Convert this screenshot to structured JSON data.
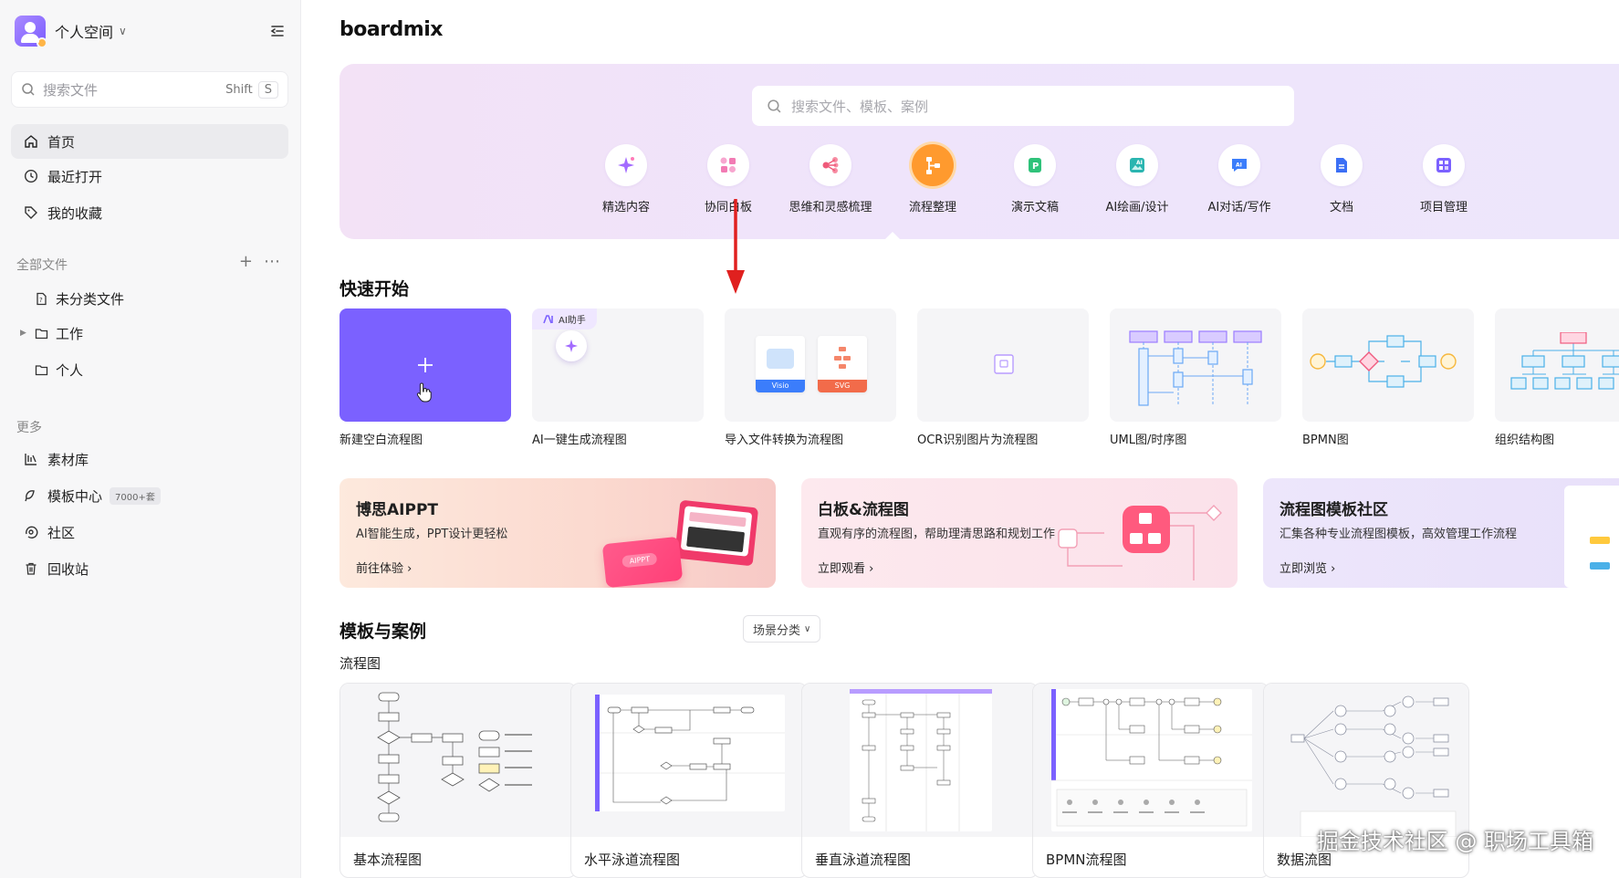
{
  "sidebar": {
    "space_name": "个人空间",
    "search": {
      "placeholder": "搜索文件",
      "shortcut_1": "Shift",
      "shortcut_2": "S"
    },
    "nav": [
      {
        "label": "首页",
        "icon": "home-icon",
        "active": true
      },
      {
        "label": "最近打开",
        "icon": "clock-icon"
      },
      {
        "label": "我的收藏",
        "icon": "tag-icon"
      }
    ],
    "files_section": "全部文件",
    "tree": [
      {
        "label": "未分类文件",
        "icon": "file-icon"
      },
      {
        "label": "工作",
        "icon": "folder-icon"
      },
      {
        "label": "个人",
        "icon": "folder-icon"
      }
    ],
    "more_section": "更多",
    "more": [
      {
        "label": "素材库",
        "icon": "library-icon"
      },
      {
        "label": "模板中心",
        "icon": "template-icon",
        "badge": "7000+套"
      },
      {
        "label": "社区",
        "icon": "community-icon"
      },
      {
        "label": "回收站",
        "icon": "trash-icon"
      }
    ]
  },
  "main": {
    "logo": "boardmix",
    "hero_search_placeholder": "搜索文件、模板、案例",
    "categories": [
      {
        "label": "精选内容",
        "icon": "sparkle-icon",
        "color": "#a36bff"
      },
      {
        "label": "协同白板",
        "icon": "whiteboard-icon",
        "color": "#f27bb4"
      },
      {
        "label": "思维和灵感梳理",
        "icon": "mindmap-icon",
        "color": "#ef5a7a"
      },
      {
        "label": "流程整理",
        "icon": "flowchart-icon",
        "color": "#ff9a2e",
        "active": true
      },
      {
        "label": "演示文稿",
        "icon": "presentation-icon",
        "color": "#2fc27a"
      },
      {
        "label": "AI绘画/设计",
        "icon": "ai-paint-icon",
        "color": "#2ab5b0"
      },
      {
        "label": "AI对话/写作",
        "icon": "ai-chat-icon",
        "color": "#3b7dfb"
      },
      {
        "label": "文档",
        "icon": "document-icon",
        "color": "#3b6ff5"
      },
      {
        "label": "项目管理",
        "icon": "project-icon",
        "color": "#7b61ff"
      }
    ],
    "quick_start_title": "快速开始",
    "quick_start": [
      {
        "label": "新建空白流程图"
      },
      {
        "label": "AI一键生成流程图",
        "tag": "AI助手"
      },
      {
        "label": "导入文件转换为流程图",
        "file_tags": [
          "Visio",
          "SVG"
        ]
      },
      {
        "label": "OCR识别图片为流程图"
      },
      {
        "label": "UML图/时序图"
      },
      {
        "label": "BPMN图"
      },
      {
        "label": "组织结构图"
      }
    ],
    "promos": [
      {
        "title": "博思AIPPT",
        "desc": "AI智能生成，PPT设计更轻松",
        "link": "前往体验",
        "card_text": "AIPPT"
      },
      {
        "title": "白板&流程图",
        "desc": "直观有序的流程图，帮助理清思路和规划工作",
        "link": "立即观看"
      },
      {
        "title": "流程图模板社区",
        "desc": "汇集各种专业流程图模板，高效管理工作流程",
        "link": "立即浏览"
      }
    ],
    "templates_title": "模板与案例",
    "filter_label": "场景分类",
    "templates_subtitle": "流程图",
    "templates": [
      {
        "title": "基本流程图"
      },
      {
        "title": "水平泳道流程图"
      },
      {
        "title": "垂直泳道流程图"
      },
      {
        "title": "BPMN流程图"
      },
      {
        "title": "数据流图"
      }
    ]
  },
  "watermark": "掘金技术社区 @ 职场工具箱"
}
